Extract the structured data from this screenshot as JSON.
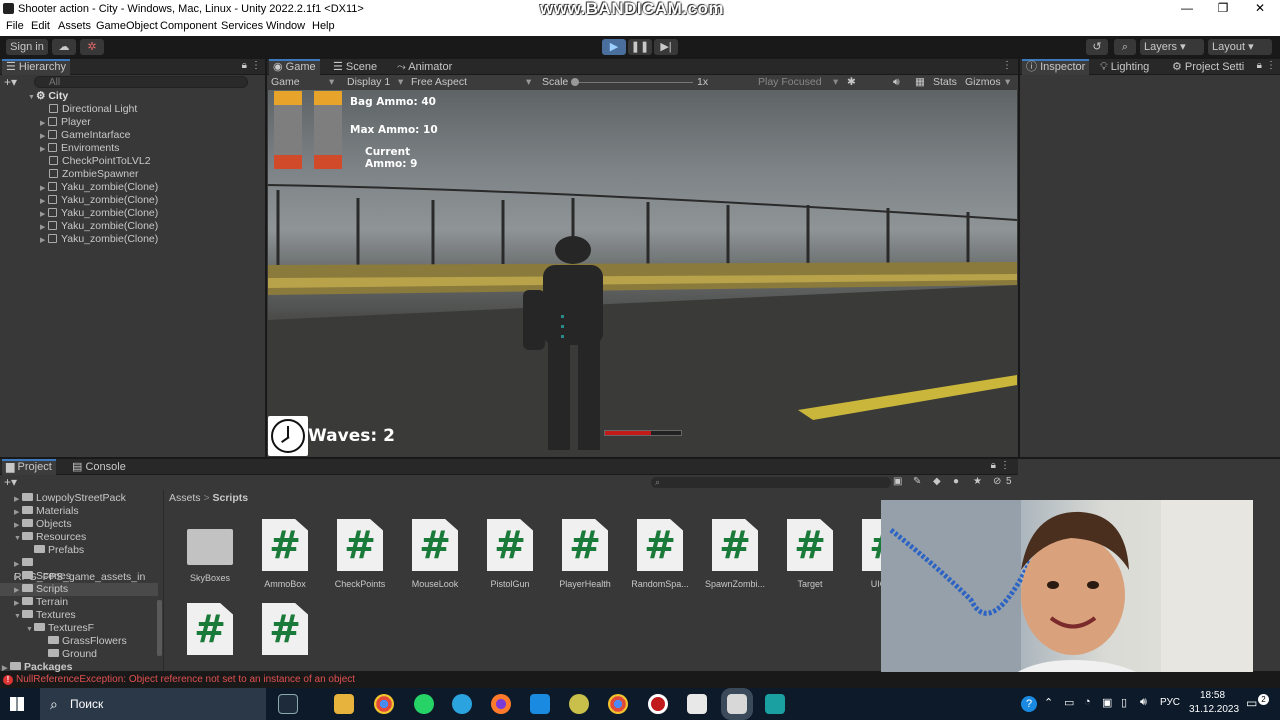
{
  "window": {
    "title": "Shooter action - City - Windows, Mac, Linux - Unity 2022.2.1f1 <DX11>",
    "watermark": "www.BANDICAM.com",
    "min": "—",
    "max": "❐",
    "close": "✕"
  },
  "menu": [
    "File",
    "Edit",
    "Assets",
    "GameObject",
    "Component",
    "Services",
    "Window",
    "Help"
  ],
  "toolbar": {
    "signin": "Sign in",
    "layers": "Layers",
    "layout": "Layout"
  },
  "hierarchy": {
    "title": "Hierarchy",
    "search_placeholder": "All",
    "scene": "City",
    "items": [
      "Directional Light",
      "Player",
      "GameIntarface",
      "Enviroments",
      "CheckPointToLVL2",
      "ZombieSpawner",
      "Yaku_zombie(Clone)",
      "Yaku_zombie(Clone)",
      "Yaku_zombie(Clone)",
      "Yaku_zombie(Clone)",
      "Yaku_zombie(Clone)"
    ]
  },
  "game": {
    "tabs": [
      "Game",
      "Scene",
      "Animator"
    ],
    "mode": "Game",
    "display": "Display 1",
    "aspect": "Free Aspect",
    "scale_label": "Scale",
    "scale_value": "1x",
    "play_focused": "Play Focused",
    "stats": "Stats",
    "gizmos": "Gizmos",
    "hud": {
      "bag_ammo": "Bag Ammo: 40",
      "max_ammo": "Max Ammo: 10",
      "current_ammo_1": "Current",
      "current_ammo_2": "Ammo: 9",
      "waves": "Waves: 2",
      "health_fraction": 0.6
    }
  },
  "inspector": {
    "tabs": [
      "Inspector",
      "Lighting",
      "Project Setti"
    ]
  },
  "project": {
    "tabs": [
      "Project",
      "Console"
    ],
    "breadcrumb": [
      "Assets",
      "Scripts"
    ],
    "hidden_count": "5",
    "tree": [
      {
        "label": "LowpolyStreetPack",
        "level": 1
      },
      {
        "label": "Materials",
        "level": 1
      },
      {
        "label": "Objects",
        "level": 1
      },
      {
        "label": "Resources",
        "level": 1
      },
      {
        "label": "Prefabs",
        "level": 2
      },
      {
        "label": "RPG_FPS_game_assets_in",
        "level": 1
      },
      {
        "label": "Scenes",
        "level": 1
      },
      {
        "label": "Scripts",
        "level": 1
      },
      {
        "label": "Terrain",
        "level": 1
      },
      {
        "label": "Textures",
        "level": 1
      },
      {
        "label": "TexturesF",
        "level": 2
      },
      {
        "label": "GrassFlowers",
        "level": 3
      },
      {
        "label": "Ground",
        "level": 3
      }
    ],
    "packages": "Packages",
    "assets": [
      "SkyBoxes",
      "AmmoBox",
      "CheckPoints",
      "MouseLook",
      "PistolGun",
      "PlayerHealth",
      "RandomSpa...",
      "SpawnZombi...",
      "Target",
      "UIGa..."
    ]
  },
  "status": {
    "error": "NullReferenceException: Object reference not set to an instance of an object"
  },
  "taskbar": {
    "search": "Поиск",
    "lang": "РУС",
    "time": "18:58",
    "date": "31.12.2023",
    "notif_count": "2"
  },
  "colors": {
    "accent": "#3a79bb",
    "unity_panel": "#383838",
    "script_green": "#1a7a3a",
    "error": "#e05050"
  }
}
